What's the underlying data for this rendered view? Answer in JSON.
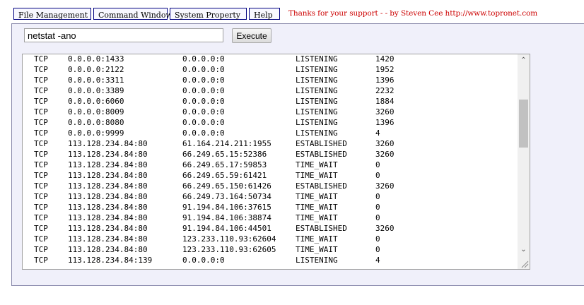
{
  "nav": {
    "items": [
      {
        "label": "File Management"
      },
      {
        "label": "Command Window"
      },
      {
        "label": "System Property"
      },
      {
        "label": "Help"
      }
    ],
    "credits": "Thanks for your support - - by Steven Cee http://www.topronet.com"
  },
  "command": {
    "value": "netstat -ano",
    "execute_label": "Execute"
  },
  "output": {
    "rows": [
      {
        "proto": "TCP",
        "local": "0.0.0.0:1433",
        "foreign": "0.0.0.0:0",
        "state": "LISTENING",
        "pid": "1420"
      },
      {
        "proto": "TCP",
        "local": "0.0.0.0:2122",
        "foreign": "0.0.0.0:0",
        "state": "LISTENING",
        "pid": "1952"
      },
      {
        "proto": "TCP",
        "local": "0.0.0.0:3311",
        "foreign": "0.0.0.0:0",
        "state": "LISTENING",
        "pid": "1396"
      },
      {
        "proto": "TCP",
        "local": "0.0.0.0:3389",
        "foreign": "0.0.0.0:0",
        "state": "LISTENING",
        "pid": "2232"
      },
      {
        "proto": "TCP",
        "local": "0.0.0.0:6060",
        "foreign": "0.0.0.0:0",
        "state": "LISTENING",
        "pid": "1884"
      },
      {
        "proto": "TCP",
        "local": "0.0.0.0:8009",
        "foreign": "0.0.0.0:0",
        "state": "LISTENING",
        "pid": "3260"
      },
      {
        "proto": "TCP",
        "local": "0.0.0.0:8080",
        "foreign": "0.0.0.0:0",
        "state": "LISTENING",
        "pid": "1396"
      },
      {
        "proto": "TCP",
        "local": "0.0.0.0:9999",
        "foreign": "0.0.0.0:0",
        "state": "LISTENING",
        "pid": "4"
      },
      {
        "proto": "TCP",
        "local": "113.128.234.84:80",
        "foreign": "61.164.214.211:1955",
        "state": "ESTABLISHED",
        "pid": "3260"
      },
      {
        "proto": "TCP",
        "local": "113.128.234.84:80",
        "foreign": "66.249.65.15:52386",
        "state": "ESTABLISHED",
        "pid": "3260"
      },
      {
        "proto": "TCP",
        "local": "113.128.234.84:80",
        "foreign": "66.249.65.17:59853",
        "state": "TIME_WAIT",
        "pid": "0"
      },
      {
        "proto": "TCP",
        "local": "113.128.234.84:80",
        "foreign": "66.249.65.59:61421",
        "state": "TIME_WAIT",
        "pid": "0"
      },
      {
        "proto": "TCP",
        "local": "113.128.234.84:80",
        "foreign": "66.249.65.150:61426",
        "state": "ESTABLISHED",
        "pid": "3260"
      },
      {
        "proto": "TCP",
        "local": "113.128.234.84:80",
        "foreign": "66.249.73.164:50734",
        "state": "TIME_WAIT",
        "pid": "0"
      },
      {
        "proto": "TCP",
        "local": "113.128.234.84:80",
        "foreign": "91.194.84.106:37615",
        "state": "TIME_WAIT",
        "pid": "0"
      },
      {
        "proto": "TCP",
        "local": "113.128.234.84:80",
        "foreign": "91.194.84.106:38874",
        "state": "TIME_WAIT",
        "pid": "0"
      },
      {
        "proto": "TCP",
        "local": "113.128.234.84:80",
        "foreign": "91.194.84.106:44501",
        "state": "ESTABLISHED",
        "pid": "3260"
      },
      {
        "proto": "TCP",
        "local": "113.128.234.84:80",
        "foreign": "123.233.110.93:62604",
        "state": "TIME_WAIT",
        "pid": "0"
      },
      {
        "proto": "TCP",
        "local": "113.128.234.84:80",
        "foreign": "123.233.110.93:62605",
        "state": "TIME_WAIT",
        "pid": "0"
      },
      {
        "proto": "TCP",
        "local": "113.128.234.84:139",
        "foreign": "0.0.0.0:0",
        "state": "LISTENING",
        "pid": "4"
      }
    ],
    "scroll_up_icon": "chevron-up-icon",
    "scroll_down_icon": "chevron-down-icon"
  },
  "colors": {
    "credits_text": "#cc0000",
    "nav_border": "#000080",
    "panel_background": "#f0f0fa"
  }
}
